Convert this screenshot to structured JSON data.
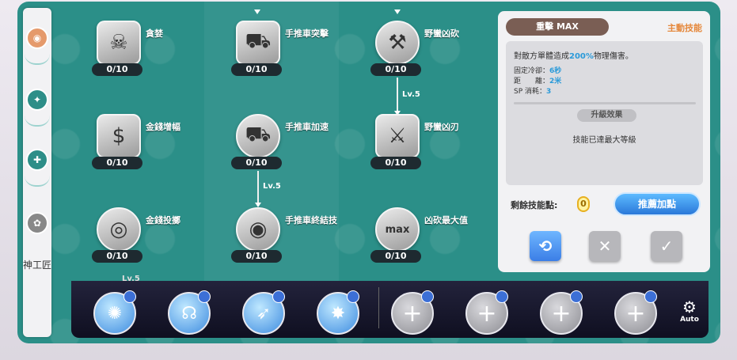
{
  "sidebar": {
    "label": "神工匠",
    "tabs": [
      {
        "icon": "cart-icon"
      },
      {
        "icon": "axe-icon"
      },
      {
        "icon": "hammer-icon"
      },
      {
        "icon": "job-icon"
      }
    ]
  },
  "skills": [
    {
      "name": "貪婪",
      "count": "0/10",
      "icon": "skull-bag-icon"
    },
    {
      "name": "手推車突擊",
      "count": "0/10",
      "icon": "cart-charge-icon"
    },
    {
      "name": "野蠻凶砍",
      "count": "0/10",
      "icon": "axe-chop-icon"
    },
    {
      "name": "金錢增幅",
      "count": "0/10",
      "icon": "money-bag-icon"
    },
    {
      "name": "手推車加速",
      "count": "0/10",
      "icon": "cart-speed-icon"
    },
    {
      "name": "野蠻凶刃",
      "count": "0/10",
      "icon": "axe-blade-icon"
    },
    {
      "name": "金錢投擲",
      "count": "0/10",
      "icon": "coin-throw-icon"
    },
    {
      "name": "手推車終結技",
      "count": "0/10",
      "icon": "cart-finisher-icon"
    },
    {
      "name": "凶砍最大值",
      "count": "0/10",
      "icon": "max-chop-icon"
    }
  ],
  "level_labels": [
    "Lv.5",
    "Lv.5",
    "Lv.5"
  ],
  "detail": {
    "title": "重擊 MAX",
    "type": "主動技能",
    "desc_prefix": "對敵方單體造成",
    "desc_highlight": "200%",
    "desc_suffix": "物理傷害。",
    "stats": [
      {
        "label": "固定冷卻：",
        "value": "6秒"
      },
      {
        "label": "距　　離：",
        "value": "2米"
      },
      {
        "label": "SP 消耗：",
        "value": "3"
      }
    ],
    "upgrade_label": "升級效果",
    "max_note": "技能已達最大等級",
    "points_label": "剩餘技能點:",
    "points_value": "0",
    "recommend_label": "推薦加點",
    "colors": {
      "accent": "#2a9ad9",
      "type": "#e5883c",
      "panel_bg": "#2b8f88"
    }
  },
  "skill_bar": {
    "slots": [
      {
        "type": "skill",
        "icon": "cart-spin-icon"
      },
      {
        "type": "skill",
        "icon": "shout-icon"
      },
      {
        "type": "skill",
        "icon": "run-icon"
      },
      {
        "type": "skill",
        "icon": "impact-icon"
      },
      {
        "type": "empty",
        "icon": "plus-icon"
      },
      {
        "type": "empty",
        "icon": "plus-icon"
      },
      {
        "type": "empty",
        "icon": "plus-icon"
      },
      {
        "type": "empty",
        "icon": "plus-icon"
      }
    ],
    "auto_label": "Auto"
  }
}
